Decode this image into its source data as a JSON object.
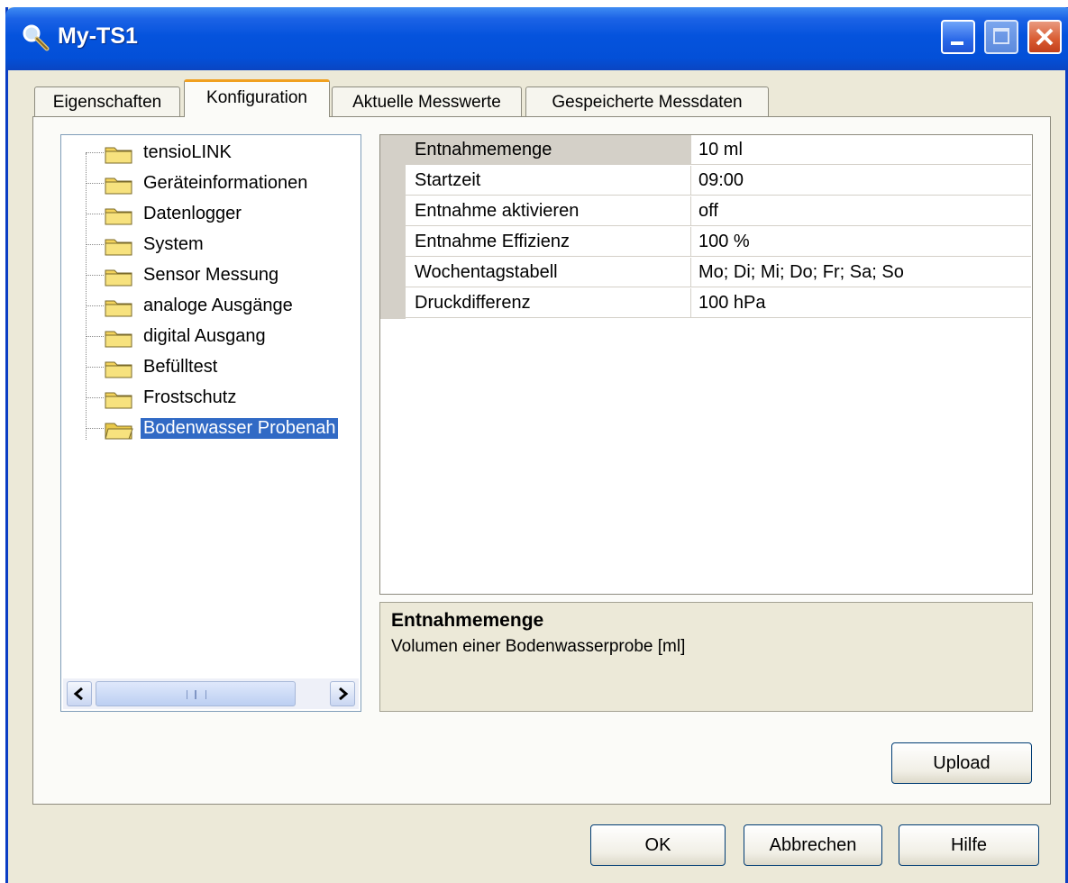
{
  "window": {
    "title": "My-TS1"
  },
  "tabs": [
    {
      "label": "Eigenschaften"
    },
    {
      "label": "Konfiguration"
    },
    {
      "label": "Aktuelle Messwerte"
    },
    {
      "label": "Gespeicherte Messdaten"
    }
  ],
  "tree": {
    "items": [
      {
        "label": "tensioLINK"
      },
      {
        "label": "Geräteinformationen"
      },
      {
        "label": "Datenlogger"
      },
      {
        "label": "System"
      },
      {
        "label": "Sensor Messung"
      },
      {
        "label": "analoge Ausgänge"
      },
      {
        "label": "digital Ausgang"
      },
      {
        "label": "Befülltest"
      },
      {
        "label": "Frostschutz"
      },
      {
        "label": "Bodenwasser Probenah"
      }
    ],
    "scroll_grip": "III"
  },
  "properties": {
    "rows": [
      {
        "name": "Entnahmemenge",
        "value": "10 ml"
      },
      {
        "name": "Startzeit",
        "value": "09:00"
      },
      {
        "name": "Entnahme aktivieren",
        "value": "off"
      },
      {
        "name": "Entnahme Effizienz",
        "value": "100 %"
      },
      {
        "name": "Wochentagstabell",
        "value": "Mo; Di; Mi; Do; Fr; Sa; So"
      },
      {
        "name": "Druckdifferenz",
        "value": "100 hPa"
      }
    ]
  },
  "description": {
    "title": "Entnahmemenge",
    "text": "Volumen einer Bodenwasserprobe [ml]"
  },
  "buttons": {
    "upload": "Upload",
    "ok": "OK",
    "cancel": "Abbrechen",
    "help": "Hilfe"
  },
  "colors": {
    "titlebar": "#0553dd",
    "selection": "#316ac5",
    "active_tab_accent": "#f0a020",
    "dialog_bg": "#ece9d8"
  }
}
